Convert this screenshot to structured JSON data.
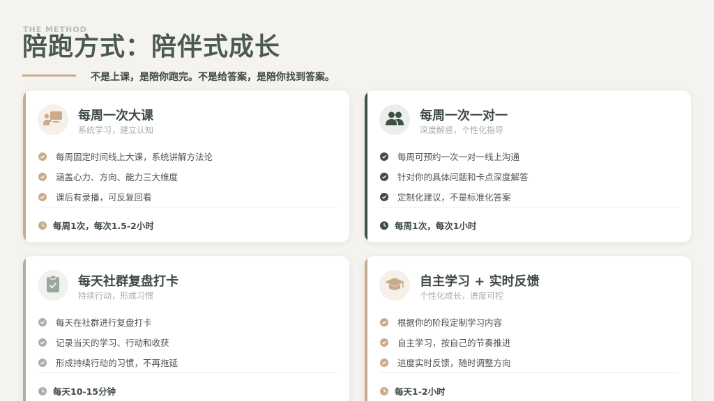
{
  "header": {
    "eyebrow": "THE METHOD",
    "title": "陪跑方式：陪伴式成长",
    "subtitle": "不是上课，是陪你跑完。不是给答案，是陪你找到答案。"
  },
  "colors": {
    "background": "#f5f3ef",
    "tan": "#c9ab8b",
    "dark_green": "#3e4f43",
    "sage": "#a6b2a6"
  },
  "cards": [
    {
      "icon": "presentation-icon",
      "title": "每周一次大课",
      "subtitle": "系统学习，建立认知",
      "items": [
        "每周固定时间线上大课，系统讲解方法论",
        "涵盖心力、方向、能力三大维度",
        "课后有录播，可反复回看"
      ],
      "footer": "每周1次，每次1.5-2小时"
    },
    {
      "icon": "users-icon",
      "title": "每周一次一对一",
      "subtitle": "深度解惑，个性化指导",
      "items": [
        "每周可预约一次一对一线上沟通",
        "针对你的具体问题和卡点深度解答",
        "定制化建议，不是标准化答案"
      ],
      "footer": "每周1次，每次1小时"
    },
    {
      "icon": "clipboard-check-icon",
      "title": "每天社群复盘打卡",
      "subtitle": "持续行动，形成习惯",
      "items": [
        "每天在社群进行复盘打卡",
        "记录当天的学习、行动和收获",
        "形成持续行动的习惯，不再拖延"
      ],
      "footer": "每天10-15分钟"
    },
    {
      "icon": "graduation-cap-icon",
      "title": "自主学习 + 实时反馈",
      "subtitle": "个性化成长，进度可控",
      "items": [
        "根据你的阶段定制学习内容",
        "自主学习，按自己的节奏推进",
        "进度实时反馈，随时调整方向"
      ],
      "footer": "每天1-2小时"
    }
  ]
}
